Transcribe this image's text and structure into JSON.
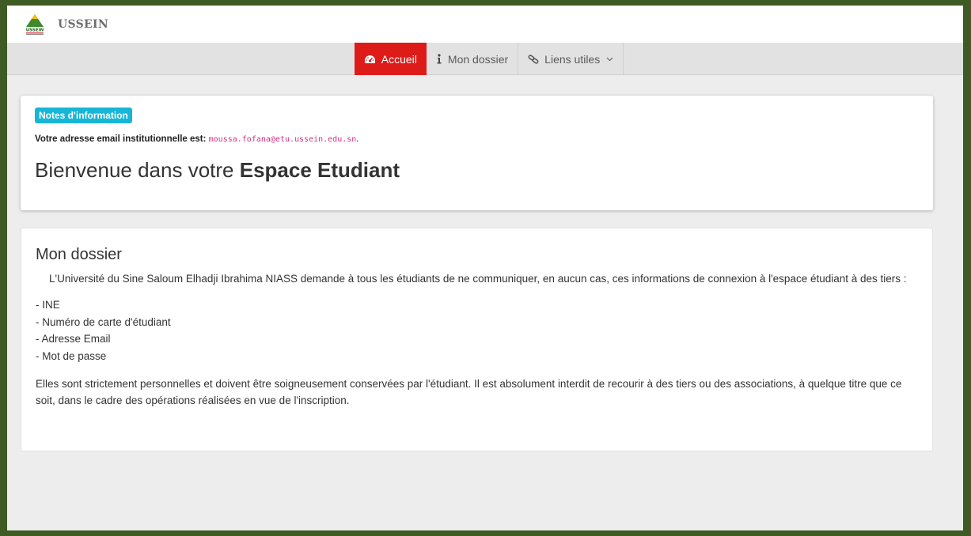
{
  "header": {
    "logo_icon": "ussein-mountain-logo",
    "logo_text": "USSEIN",
    "brand": "USSEIN"
  },
  "nav": {
    "items": [
      {
        "label": "Accueil",
        "icon": "dashboard-icon",
        "active": true
      },
      {
        "label": "Mon dossier",
        "icon": "info-icon",
        "active": false
      },
      {
        "label": "Liens utiles",
        "icon": "link-icon",
        "active": false,
        "dropdown": true
      }
    ]
  },
  "info_card": {
    "badge": "Notes d'information",
    "email_label": "Votre adresse email institutionnelle est:",
    "email_value": "moussa.fofana@etu.ussein.edu.sn",
    "email_suffix": ".",
    "welcome_prefix": "Bienvenue dans votre",
    "welcome_strong": "Espace Etudiant"
  },
  "dossier": {
    "title": "Mon dossier",
    "intro": "L'Université du Sine Saloum Elhadji Ibrahima NIASS demande à tous les étudiants de ne communiquer, en aucun cas, ces informations de connexion à l'espace étudiant à des tiers :",
    "items": [
      "- INE",
      "- Numéro de carte d'étudiant",
      "- Adresse Email",
      "- Mot de passe"
    ],
    "note": "Elles sont strictement personnelles et doivent être soigneusement conservées par l'étudiant. Il est absolument interdit de recourir à des tiers ou des associations, à quelque titre que ce soit, dans le cadre des opérations réalisées en vue de l'inscription."
  },
  "colors": {
    "frame": "#3d5b22",
    "active_nav": "#dd1c1a",
    "badge": "#17b6d6",
    "email_code": "#d63384"
  }
}
